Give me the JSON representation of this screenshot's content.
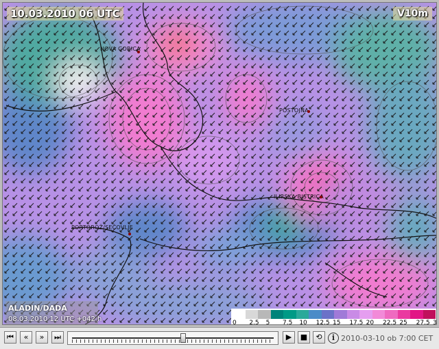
{
  "map": {
    "date_label": "10.03.2010 06 UTC",
    "variable_label": "V10m",
    "model_name": "ALADIN/DADA",
    "model_run": "08.03.2010 12 UTC +042 h",
    "places": [
      {
        "name": "NOVA GORICA",
        "dot": true
      },
      {
        "name": "POSTOJNA",
        "dot": true
      },
      {
        "name": "ILIRSKA BISTRICA",
        "dot": true
      },
      {
        "name": "PORTOROŽ/SEČOVLJE",
        "dot": true
      }
    ]
  },
  "legend": {
    "ticks": [
      "0",
      "2.5",
      "5",
      "7.5",
      "10",
      "12.5",
      "15",
      "17.5",
      "20",
      "22.5",
      "25",
      "27.5",
      "30"
    ],
    "colors": [
      "#ffffff",
      "#d8d8d8",
      "#b8b8b8",
      "#00837a",
      "#009a86",
      "#2aa99a",
      "#4b8cc8",
      "#6b72c8",
      "#a07ad8",
      "#c98be6",
      "#e59ef0",
      "#f28ad8",
      "#ef6ac0",
      "#ea3aa0",
      "#e21585",
      "#c0105c"
    ]
  },
  "controls": {
    "first_label": "⏮",
    "prev_label": "«",
    "next_label": "»",
    "last_label": "⏭",
    "play_label": "▶",
    "stop_label": "■",
    "loop_label": "⟲",
    "info_label": "i",
    "timestamp": "2010-03-10 ob 7:00 CET",
    "slider_position": 0.55
  },
  "colors": {
    "arrow": "#1a1a1a",
    "contour": "#555555",
    "border_line": "#111111"
  }
}
